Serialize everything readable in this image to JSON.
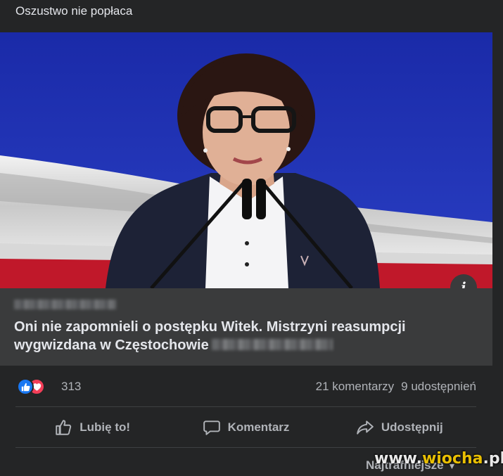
{
  "post": {
    "text": "Oszustwo nie popłaca"
  },
  "link_card": {
    "title": "Oni nie zapomnieli o postępku Witek. Mistrzyni reasumpcji wygwizdana w Częstochowie",
    "info_icon": "info-icon",
    "image_icon": "photo-of-speaker-at-lectern"
  },
  "reactions": {
    "count": "313",
    "icons": [
      "like-icon",
      "love-icon"
    ]
  },
  "stats": {
    "comments": "21 komentarzy",
    "shares": "9 udostępnień"
  },
  "actions": {
    "like": "Lubię to!",
    "comment": "Komentarz",
    "share": "Udostępnij"
  },
  "sort": {
    "label": "Najtrafniejsze"
  },
  "watermark": {
    "prefix": "www.",
    "brand": "wiocha",
    "suffix": ".pl"
  },
  "colors": {
    "background": "#242526",
    "card": "#3a3b3c",
    "text_primary": "#e4e6eb",
    "text_secondary": "#b0b3b8",
    "like_blue": "#1877f2",
    "love_red": "#f33e58"
  }
}
